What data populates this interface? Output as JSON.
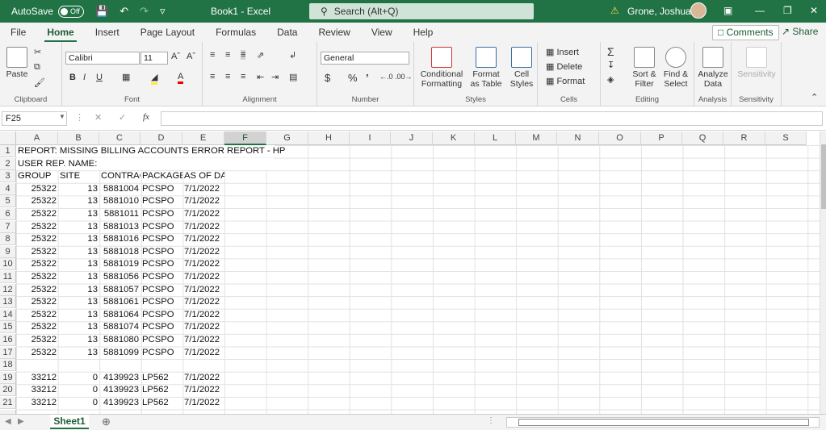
{
  "titlebar": {
    "autosave_label": "AutoSave",
    "autosave_state": "Off",
    "doc_title": "Book1  -  Excel",
    "search_placeholder": "Search (Alt+Q)",
    "user_name": "Grone, Joshua G"
  },
  "menu": {
    "items": [
      "File",
      "Home",
      "Insert",
      "Page Layout",
      "Formulas",
      "Data",
      "Review",
      "View",
      "Help"
    ],
    "active": "Home",
    "comments_label": "Comments",
    "share_label": "Share"
  },
  "ribbon": {
    "clipboard": {
      "paste": "Paste",
      "label": "Clipboard"
    },
    "font": {
      "name": "Calibri",
      "size": "11",
      "label": "Font"
    },
    "alignment": {
      "label": "Alignment"
    },
    "number": {
      "format": "General",
      "label": "Number"
    },
    "styles": {
      "conditional": "Conditional Formatting",
      "format_table": "Format as Table",
      "cell_styles": "Cell Styles",
      "label": "Styles"
    },
    "cells": {
      "insert": "Insert",
      "delete": "Delete",
      "format": "Format",
      "label": "Cells"
    },
    "editing": {
      "sort": "Sort & Filter",
      "find": "Find & Select",
      "label": "Editing"
    },
    "analysis": {
      "analyze": "Analyze Data",
      "label": "Analysis"
    },
    "sensitivity": {
      "btn": "Sensitivity",
      "label": "Sensitivity"
    }
  },
  "formula_bar": {
    "name_box": "F25",
    "fx": "fx",
    "value": ""
  },
  "grid": {
    "columns": [
      "A",
      "B",
      "C",
      "D",
      "E",
      "F",
      "G",
      "H",
      "I",
      "J",
      "K",
      "L",
      "M",
      "N",
      "O",
      "P",
      "Q",
      "R",
      "S"
    ],
    "selected_column": "F",
    "rows": [
      {
        "n": "1",
        "A": "REPORT: MISSING BILLING ACCOUNTS ERROR REPORT - HP",
        "B": "",
        "C": "",
        "D": "",
        "E": ""
      },
      {
        "n": "2",
        "A": "USER REP. NAME:",
        "B": "",
        "C": "",
        "D": "",
        "E": ""
      },
      {
        "n": "3",
        "A": "GROUP",
        "B": "SITE",
        "C": "CONTRACT",
        "D": "PACKAGE",
        "E": "AS OF DATE"
      },
      {
        "n": "4",
        "A": "25322",
        "B": "13",
        "C": "5881004",
        "D": "PCSPO",
        "E": "7/1/2022"
      },
      {
        "n": "5",
        "A": "25322",
        "B": "13",
        "C": "5881010",
        "D": "PCSPO",
        "E": "7/1/2022"
      },
      {
        "n": "6",
        "A": "25322",
        "B": "13",
        "C": "5881011",
        "D": "PCSPO",
        "E": "7/1/2022"
      },
      {
        "n": "7",
        "A": "25322",
        "B": "13",
        "C": "5881013",
        "D": "PCSPO",
        "E": "7/1/2022"
      },
      {
        "n": "8",
        "A": "25322",
        "B": "13",
        "C": "5881016",
        "D": "PCSPO",
        "E": "7/1/2022"
      },
      {
        "n": "9",
        "A": "25322",
        "B": "13",
        "C": "5881018",
        "D": "PCSPO",
        "E": "7/1/2022"
      },
      {
        "n": "10",
        "A": "25322",
        "B": "13",
        "C": "5881019",
        "D": "PCSPO",
        "E": "7/1/2022"
      },
      {
        "n": "11",
        "A": "25322",
        "B": "13",
        "C": "5881056",
        "D": "PCSPO",
        "E": "7/1/2022"
      },
      {
        "n": "12",
        "A": "25322",
        "B": "13",
        "C": "5881057",
        "D": "PCSPO",
        "E": "7/1/2022"
      },
      {
        "n": "13",
        "A": "25322",
        "B": "13",
        "C": "5881061",
        "D": "PCSPO",
        "E": "7/1/2022"
      },
      {
        "n": "14",
        "A": "25322",
        "B": "13",
        "C": "5881064",
        "D": "PCSPO",
        "E": "7/1/2022"
      },
      {
        "n": "15",
        "A": "25322",
        "B": "13",
        "C": "5881074",
        "D": "PCSPO",
        "E": "7/1/2022"
      },
      {
        "n": "16",
        "A": "25322",
        "B": "13",
        "C": "5881080",
        "D": "PCSPO",
        "E": "7/1/2022"
      },
      {
        "n": "17",
        "A": "25322",
        "B": "13",
        "C": "5881099",
        "D": "PCSPO",
        "E": "7/1/2022"
      },
      {
        "n": "18",
        "A": "",
        "B": "",
        "C": "",
        "D": "",
        "E": ""
      },
      {
        "n": "19",
        "A": "33212",
        "B": "0",
        "C": "4139923",
        "D": "LP562",
        "E": "7/1/2022"
      },
      {
        "n": "20",
        "A": "33212",
        "B": "0",
        "C": "4139923",
        "D": "LP562",
        "E": "7/1/2022"
      },
      {
        "n": "21",
        "A": "33212",
        "B": "0",
        "C": "4139923",
        "D": "LP562",
        "E": "7/1/2022"
      }
    ]
  },
  "sheets": {
    "active": "Sheet1"
  },
  "colors": {
    "accent": "#217346",
    "ribbon_bg": "#f3f3f3"
  }
}
